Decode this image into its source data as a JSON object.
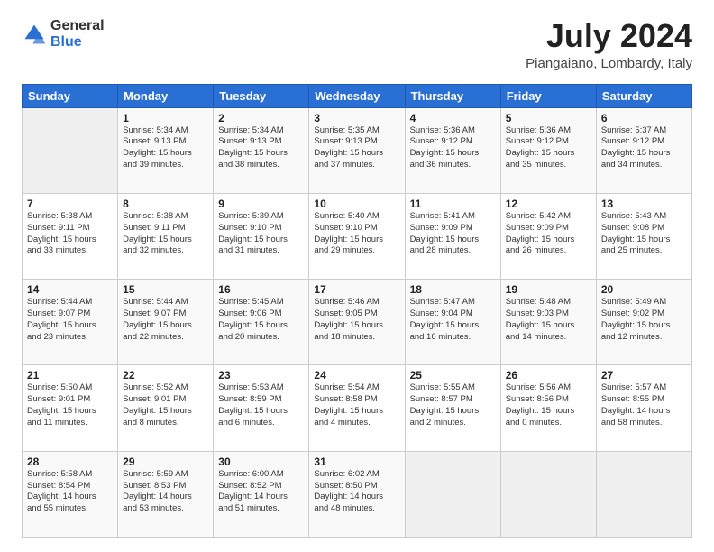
{
  "logo": {
    "general": "General",
    "blue": "Blue"
  },
  "title": "July 2024",
  "subtitle": "Piangaiano, Lombardy, Italy",
  "header_days": [
    "Sunday",
    "Monday",
    "Tuesday",
    "Wednesday",
    "Thursday",
    "Friday",
    "Saturday"
  ],
  "weeks": [
    [
      {
        "day": "",
        "info": ""
      },
      {
        "day": "1",
        "info": "Sunrise: 5:34 AM\nSunset: 9:13 PM\nDaylight: 15 hours\nand 39 minutes."
      },
      {
        "day": "2",
        "info": "Sunrise: 5:34 AM\nSunset: 9:13 PM\nDaylight: 15 hours\nand 38 minutes."
      },
      {
        "day": "3",
        "info": "Sunrise: 5:35 AM\nSunset: 9:13 PM\nDaylight: 15 hours\nand 37 minutes."
      },
      {
        "day": "4",
        "info": "Sunrise: 5:36 AM\nSunset: 9:12 PM\nDaylight: 15 hours\nand 36 minutes."
      },
      {
        "day": "5",
        "info": "Sunrise: 5:36 AM\nSunset: 9:12 PM\nDaylight: 15 hours\nand 35 minutes."
      },
      {
        "day": "6",
        "info": "Sunrise: 5:37 AM\nSunset: 9:12 PM\nDaylight: 15 hours\nand 34 minutes."
      }
    ],
    [
      {
        "day": "7",
        "info": "Sunrise: 5:38 AM\nSunset: 9:11 PM\nDaylight: 15 hours\nand 33 minutes."
      },
      {
        "day": "8",
        "info": "Sunrise: 5:38 AM\nSunset: 9:11 PM\nDaylight: 15 hours\nand 32 minutes."
      },
      {
        "day": "9",
        "info": "Sunrise: 5:39 AM\nSunset: 9:10 PM\nDaylight: 15 hours\nand 31 minutes."
      },
      {
        "day": "10",
        "info": "Sunrise: 5:40 AM\nSunset: 9:10 PM\nDaylight: 15 hours\nand 29 minutes."
      },
      {
        "day": "11",
        "info": "Sunrise: 5:41 AM\nSunset: 9:09 PM\nDaylight: 15 hours\nand 28 minutes."
      },
      {
        "day": "12",
        "info": "Sunrise: 5:42 AM\nSunset: 9:09 PM\nDaylight: 15 hours\nand 26 minutes."
      },
      {
        "day": "13",
        "info": "Sunrise: 5:43 AM\nSunset: 9:08 PM\nDaylight: 15 hours\nand 25 minutes."
      }
    ],
    [
      {
        "day": "14",
        "info": "Sunrise: 5:44 AM\nSunset: 9:07 PM\nDaylight: 15 hours\nand 23 minutes."
      },
      {
        "day": "15",
        "info": "Sunrise: 5:44 AM\nSunset: 9:07 PM\nDaylight: 15 hours\nand 22 minutes."
      },
      {
        "day": "16",
        "info": "Sunrise: 5:45 AM\nSunset: 9:06 PM\nDaylight: 15 hours\nand 20 minutes."
      },
      {
        "day": "17",
        "info": "Sunrise: 5:46 AM\nSunset: 9:05 PM\nDaylight: 15 hours\nand 18 minutes."
      },
      {
        "day": "18",
        "info": "Sunrise: 5:47 AM\nSunset: 9:04 PM\nDaylight: 15 hours\nand 16 minutes."
      },
      {
        "day": "19",
        "info": "Sunrise: 5:48 AM\nSunset: 9:03 PM\nDaylight: 15 hours\nand 14 minutes."
      },
      {
        "day": "20",
        "info": "Sunrise: 5:49 AM\nSunset: 9:02 PM\nDaylight: 15 hours\nand 12 minutes."
      }
    ],
    [
      {
        "day": "21",
        "info": "Sunrise: 5:50 AM\nSunset: 9:01 PM\nDaylight: 15 hours\nand 11 minutes."
      },
      {
        "day": "22",
        "info": "Sunrise: 5:52 AM\nSunset: 9:01 PM\nDaylight: 15 hours\nand 8 minutes."
      },
      {
        "day": "23",
        "info": "Sunrise: 5:53 AM\nSunset: 8:59 PM\nDaylight: 15 hours\nand 6 minutes."
      },
      {
        "day": "24",
        "info": "Sunrise: 5:54 AM\nSunset: 8:58 PM\nDaylight: 15 hours\nand 4 minutes."
      },
      {
        "day": "25",
        "info": "Sunrise: 5:55 AM\nSunset: 8:57 PM\nDaylight: 15 hours\nand 2 minutes."
      },
      {
        "day": "26",
        "info": "Sunrise: 5:56 AM\nSunset: 8:56 PM\nDaylight: 15 hours\nand 0 minutes."
      },
      {
        "day": "27",
        "info": "Sunrise: 5:57 AM\nSunset: 8:55 PM\nDaylight: 14 hours\nand 58 minutes."
      }
    ],
    [
      {
        "day": "28",
        "info": "Sunrise: 5:58 AM\nSunset: 8:54 PM\nDaylight: 14 hours\nand 55 minutes."
      },
      {
        "day": "29",
        "info": "Sunrise: 5:59 AM\nSunset: 8:53 PM\nDaylight: 14 hours\nand 53 minutes."
      },
      {
        "day": "30",
        "info": "Sunrise: 6:00 AM\nSunset: 8:52 PM\nDaylight: 14 hours\nand 51 minutes."
      },
      {
        "day": "31",
        "info": "Sunrise: 6:02 AM\nSunset: 8:50 PM\nDaylight: 14 hours\nand 48 minutes."
      },
      {
        "day": "",
        "info": ""
      },
      {
        "day": "",
        "info": ""
      },
      {
        "day": "",
        "info": ""
      }
    ]
  ]
}
